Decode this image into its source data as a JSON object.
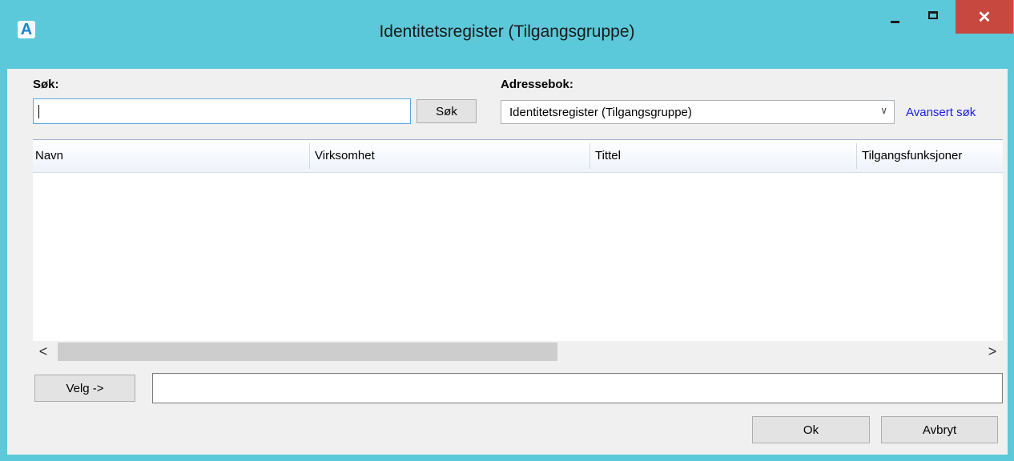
{
  "window": {
    "title": "Identitetsregister (Tilgangsgruppe)",
    "icon_letter": "A",
    "close_glyph": "✕"
  },
  "search": {
    "label": "Søk:",
    "value": "",
    "button_label": "Søk"
  },
  "addressbook": {
    "label": "Adressebok:",
    "selected": "Identitetsregister (Tilgangsgruppe)",
    "advanced_link": "Avansert søk"
  },
  "table": {
    "columns": [
      "Navn",
      "Virksomhet",
      "Tittel",
      "Tilgangsfunksjoner"
    ],
    "rows": []
  },
  "scrollbar": {
    "left_glyph": "<",
    "right_glyph": ">"
  },
  "selection": {
    "button_label": "Velg ->",
    "value": ""
  },
  "footer": {
    "ok_label": "Ok",
    "cancel_label": "Avbryt"
  },
  "colors": {
    "titlebar": "#5bc9d9",
    "close_button": "#c7483f",
    "link": "#1a1ae6"
  }
}
